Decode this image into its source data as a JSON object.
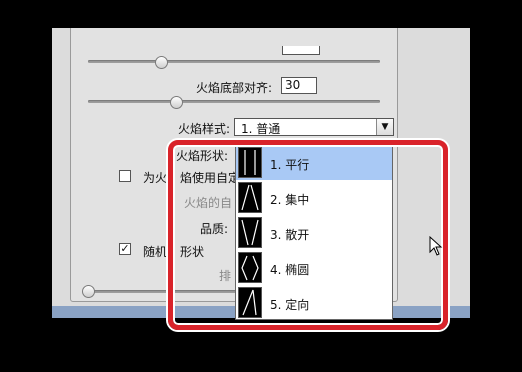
{
  "fields": {
    "top_value": "",
    "bottom_align_label": "火焰底部对齐:",
    "bottom_align_value": "30",
    "style_label": "火焰样式:",
    "style_value": "1. 普通",
    "shape_label": "火焰形状:",
    "custom_color_label": "为火焰使用自定颜",
    "custom_color_partial_a": "为火",
    "custom_color_partial_b": "焰使用自定颜",
    "flame_self_label": "火焰的自",
    "quality_label": "品质:",
    "random_shape_label": "随机",
    "random_shape_label_b": "形状",
    "sort_label": "排"
  },
  "dropdown": {
    "options": [
      {
        "label": "1. 平行",
        "icon": "parallel-flame-icon",
        "selected": true
      },
      {
        "label": "2. 集中",
        "icon": "converge-flame-icon",
        "selected": false
      },
      {
        "label": "3. 散开",
        "icon": "spread-flame-icon",
        "selected": false
      },
      {
        "label": "4. 椭圆",
        "icon": "ellipse-flame-icon",
        "selected": false
      },
      {
        "label": "5. 定向",
        "icon": "directional-flame-icon",
        "selected": false
      }
    ]
  },
  "colors": {
    "highlight": "#a9c9f5",
    "annotation": "#d9232a",
    "background": "#000000"
  }
}
